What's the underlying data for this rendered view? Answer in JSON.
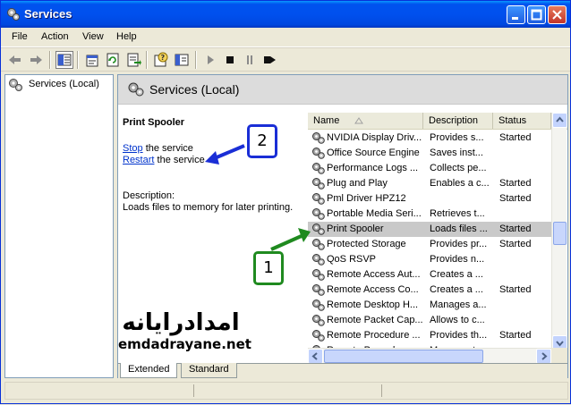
{
  "window": {
    "title": "Services"
  },
  "menu": [
    "File",
    "Action",
    "View",
    "Help"
  ],
  "tree": {
    "root_label": "Services (Local)"
  },
  "panel": {
    "title": "Services (Local)"
  },
  "selected_service": {
    "name": "Print Spooler",
    "stop_link": "Stop",
    "stop_suffix": " the service",
    "restart_link": "Restart",
    "restart_suffix": " the service",
    "description_label": "Description:",
    "description": "Loads files to memory for later printing."
  },
  "list": {
    "columns": [
      "Name",
      "Description",
      "Status"
    ],
    "rows": [
      {
        "name": "NVIDIA Display Driv...",
        "description": "Provides s...",
        "status": "Started",
        "selected": false
      },
      {
        "name": "Office Source Engine",
        "description": "Saves inst...",
        "status": "",
        "selected": false
      },
      {
        "name": "Performance Logs ...",
        "description": "Collects pe...",
        "status": "",
        "selected": false
      },
      {
        "name": "Plug and Play",
        "description": "Enables a c...",
        "status": "Started",
        "selected": false
      },
      {
        "name": "Pml Driver HPZ12",
        "description": "",
        "status": "Started",
        "selected": false
      },
      {
        "name": "Portable Media Seri...",
        "description": "Retrieves t...",
        "status": "",
        "selected": false
      },
      {
        "name": "Print Spooler",
        "description": "Loads files ...",
        "status": "Started",
        "selected": true
      },
      {
        "name": "Protected Storage",
        "description": "Provides pr...",
        "status": "Started",
        "selected": false
      },
      {
        "name": "QoS RSVP",
        "description": "Provides n...",
        "status": "",
        "selected": false
      },
      {
        "name": "Remote Access Aut...",
        "description": "Creates a ...",
        "status": "",
        "selected": false
      },
      {
        "name": "Remote Access Co...",
        "description": "Creates a ...",
        "status": "Started",
        "selected": false
      },
      {
        "name": "Remote Desktop H...",
        "description": "Manages a...",
        "status": "",
        "selected": false
      },
      {
        "name": "Remote Packet Cap...",
        "description": "Allows to c...",
        "status": "",
        "selected": false
      },
      {
        "name": "Remote Procedure ...",
        "description": "Provides th...",
        "status": "Started",
        "selected": false
      },
      {
        "name": "Remote Procedure ...",
        "description": "Manages t...",
        "status": "",
        "selected": false
      }
    ]
  },
  "tabs": [
    "Extended",
    "Standard"
  ],
  "watermark": {
    "arabic": "امدادرایانه",
    "latin": "emdadrayane.net"
  },
  "callouts": {
    "one": "1",
    "two": "2"
  },
  "colors": {
    "titlebar": "#0053ee",
    "callout_one": "#1f8a1f",
    "callout_two": "#1a2ed6",
    "link": "#0033cc"
  },
  "icons": [
    "services-gear-icon",
    "back-arrow-icon",
    "forward-arrow-icon",
    "show-hide-tree-icon",
    "properties-icon",
    "refresh-icon",
    "export-list-icon",
    "help-icon",
    "console-view-icon",
    "start-icon",
    "stop-icon",
    "pause-icon",
    "restart-icon"
  ]
}
